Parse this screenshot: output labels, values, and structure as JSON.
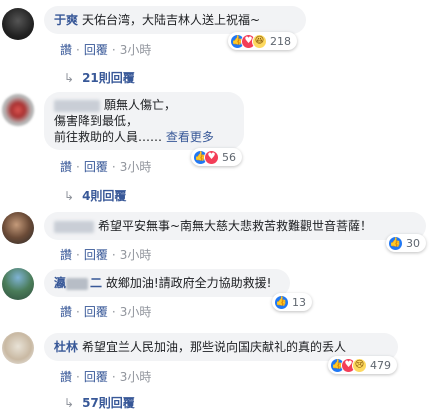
{
  "comments": [
    {
      "name": "于爽",
      "text": "天佑台湾，大陆吉林人送上祝福~",
      "actions": {
        "like": "讚",
        "reply": "回覆",
        "time": "3小時"
      },
      "reactions": {
        "icons": [
          "like-icon",
          "love-icon",
          "haha-icon"
        ],
        "count": "218"
      },
      "replies": "21則回覆"
    },
    {
      "name": "",
      "text_lines": [
        "願無人傷亡，",
        "傷害降到最低，",
        "前往救助的人員……"
      ],
      "see_more": "查看更多",
      "actions": {
        "like": "讚",
        "reply": "回覆",
        "time": "3小時"
      },
      "reactions": {
        "icons": [
          "like-icon",
          "love-icon"
        ],
        "count": "56"
      },
      "replies": "4則回覆"
    },
    {
      "name": "",
      "text": "希望平安無事~南無大慈大悲救苦救難觀世音菩薩！",
      "actions": {
        "like": "讚",
        "reply": "回覆",
        "time": "3小時"
      },
      "reactions": {
        "icons": [
          "like-icon"
        ],
        "count": "30"
      }
    },
    {
      "name": "瀛",
      "name_suffix": "二",
      "text": "故鄉加油!請政府全力協助救援!",
      "actions": {
        "like": "讚",
        "reply": "回覆",
        "time": "3小時"
      },
      "reactions": {
        "icons": [
          "like-icon"
        ],
        "count": "13"
      }
    },
    {
      "name": "杜林",
      "text": "希望宜兰人民加油，那些说向国庆献礼的真的丢人",
      "actions": {
        "like": "讚",
        "reply": "回覆",
        "time": "3小時"
      },
      "reactions": {
        "icons": [
          "like-icon",
          "love-icon",
          "sad-icon"
        ],
        "count": "479"
      },
      "replies": "57則回覆"
    }
  ],
  "colors": {
    "link": "#385898",
    "bubble": "#f2f3f5",
    "meta": "#90949c",
    "like": "#2078f4",
    "love": "#f33e58"
  }
}
